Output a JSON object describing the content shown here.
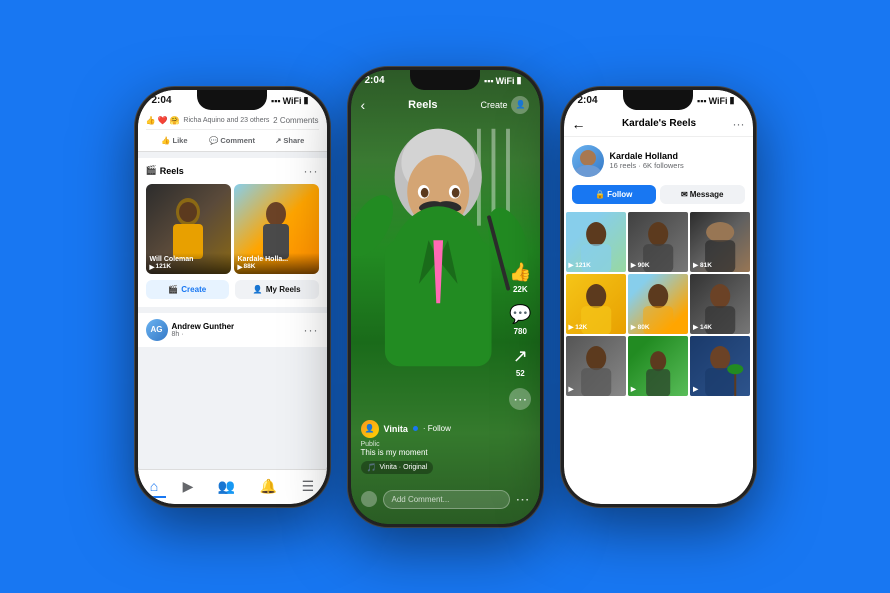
{
  "page": {
    "bg_color": "#1877F2"
  },
  "phone_left": {
    "status_time": "2:04",
    "social_text": "Richa Aquino and 23 others",
    "comments_text": "2 Comments",
    "like_label": "Like",
    "comment_label": "Comment",
    "share_label": "Share",
    "reels_section_title": "Reels",
    "reel1_name": "Will Coleman",
    "reel1_views": "121K",
    "reel2_name": "Kardale Holla...",
    "reel2_views": "88K",
    "create_btn": "Create",
    "my_reels_btn": "My Reels",
    "post_name": "Andrew Gunther",
    "post_time": "8h ·",
    "nav_home": "⌂",
    "nav_video": "▶",
    "nav_people": "👥",
    "nav_bell": "🔔",
    "nav_menu": "☰"
  },
  "phone_center": {
    "status_time": "2:04",
    "title": "Reels",
    "create_label": "Create",
    "username": "Vinita",
    "follow_label": "· Follow",
    "public_label": "Public",
    "caption": "This is my moment",
    "audio_label": "Vinita · Original",
    "likes_count": "22K",
    "comments_count": "780",
    "shares_count": "52",
    "comment_placeholder": "Add Comment...",
    "dots": "···"
  },
  "phone_right": {
    "status_time": "2:04",
    "title": "Kardale's Reels",
    "profile_name": "Kardale Holland",
    "profile_stats": "16 reels · 6K followers",
    "follow_label": "Follow",
    "message_label": "Message",
    "reels": [
      {
        "views": "▶ 121K",
        "bg": "1"
      },
      {
        "views": "▶ 90K",
        "bg": "2"
      },
      {
        "views": "▶ 81K",
        "bg": "3"
      },
      {
        "views": "▶ 12K",
        "bg": "4"
      },
      {
        "views": "▶ 80K",
        "bg": "5"
      },
      {
        "views": "▶ 14K",
        "bg": "6"
      },
      {
        "views": "▶",
        "bg": "7"
      },
      {
        "views": "▶",
        "bg": "8"
      },
      {
        "views": "▶",
        "bg": "9"
      }
    ]
  }
}
